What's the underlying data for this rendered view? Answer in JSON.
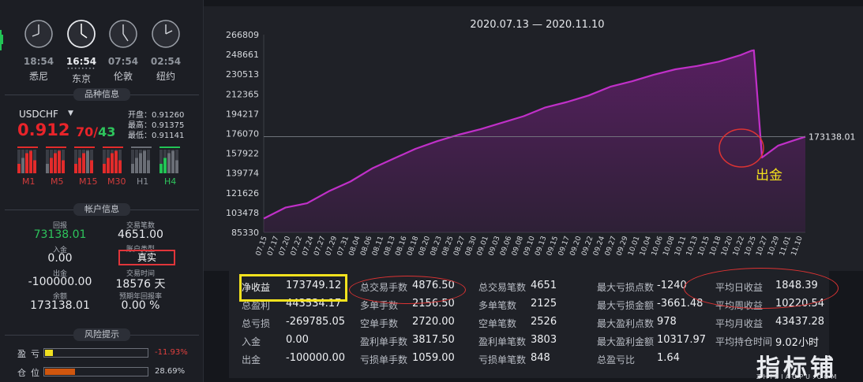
{
  "clocks": [
    {
      "time": "18:54",
      "city": "悉尼",
      "active": false
    },
    {
      "time": "16:54",
      "city": "东京",
      "active": true
    },
    {
      "time": "07:54",
      "city": "伦敦",
      "active": false
    },
    {
      "time": "02:54",
      "city": "纽约",
      "active": false
    }
  ],
  "sections": {
    "instrument": "品种信息",
    "account": "帐户信息",
    "risk": "风险提示"
  },
  "instrument": {
    "symbol": "USDCHF",
    "price_main": "0.912",
    "price_frac": "70",
    "price_sep": "/",
    "price_alt": "43",
    "open": "开盘：0.91260",
    "high": "最高：0.91375",
    "low": "最低：0.91141",
    "timeframes": [
      "M1",
      "M5",
      "M15",
      "M30",
      "H1",
      "H4"
    ],
    "bar_colors": {
      "red": "#e22b2b",
      "green": "#22c455",
      "gray": "#6a6e76"
    }
  },
  "account": {
    "equity_label": "回报",
    "equity": "73138.01",
    "trades_label": "交易笔数",
    "trades": "4651.00",
    "deposit_label": "入金",
    "deposit": "0.00",
    "type_label": "账户类型",
    "type": "真实",
    "withdraw_label": "出金",
    "withdraw": "-100000.00",
    "time_label": "交易时间",
    "time": "18576 天",
    "balance_label": "余额",
    "balance": "173138.01",
    "annual_label": "预期年回报率",
    "annual": "0.00 %"
  },
  "risk": {
    "pl_label": "盈亏",
    "pl_value": "-11.93%",
    "pl_fraction": 0.08,
    "pos_label": "仓位",
    "pos_value": "28.69%",
    "pos_fraction": 0.2869,
    "pl_color": "#f0e020",
    "pos_color": "#d0560e"
  },
  "chart_data": {
    "type": "area",
    "title": "2020.07.13 — 2020.11.10",
    "y_ticks": [
      "266809",
      "248661",
      "230513",
      "212365",
      "194217",
      "176070",
      "157922",
      "139774",
      "121626",
      "103478",
      "85330"
    ],
    "ylim": [
      85330,
      266809
    ],
    "x_ticks": [
      "07.15",
      "07.17",
      "07.20",
      "07.22",
      "07.24",
      "07.27",
      "07.29",
      "07.31",
      "08.04",
      "08.06",
      "08.11",
      "08.13",
      "08.16",
      "08.18",
      "08.20",
      "08.23",
      "08.25",
      "08.27",
      "08.30",
      "09.01",
      "09.03",
      "09.06",
      "09.08",
      "09.10",
      "09.13",
      "09.15",
      "09.17",
      "09.20",
      "09.22",
      "09.24",
      "09.27",
      "09.29",
      "10.01",
      "10.04",
      "10.06",
      "10.08",
      "10.11",
      "10.13",
      "10.15",
      "10.18",
      "10.20",
      "10.22",
      "10.25",
      "10.27",
      "10.29",
      "11.01",
      "11.10"
    ],
    "last_value": "173138.01",
    "annotation": "出金",
    "series": [
      {
        "x": [
          0,
          0.04,
          0.08,
          0.12,
          0.16,
          0.2,
          0.24,
          0.28,
          0.32,
          0.36,
          0.4,
          0.44,
          0.48,
          0.52,
          0.56,
          0.6,
          0.64,
          0.68,
          0.72,
          0.76,
          0.8,
          0.84,
          0.88,
          0.9,
          0.905,
          0.92,
          0.95,
          0.98,
          1.0
        ],
        "values": [
          98000,
          108000,
          112000,
          123000,
          132000,
          144000,
          153000,
          162000,
          169000,
          175000,
          180000,
          186000,
          192000,
          200000,
          205000,
          211000,
          219000,
          224000,
          230000,
          235000,
          238000,
          242000,
          248000,
          252000,
          252500,
          154000,
          165000,
          170000,
          173138
        ]
      }
    ],
    "colors": {
      "line": "#c030c8",
      "fill": "#5a1f63"
    }
  },
  "stats": [
    [
      {
        "label": "净收益",
        "value": "173749.12"
      },
      {
        "label": "总盈利",
        "value": "443534.17"
      },
      {
        "label": "总亏损",
        "value": "-269785.05"
      },
      {
        "label": "入金",
        "value": "0.00"
      },
      {
        "label": "出金",
        "value": "-100000.00"
      }
    ],
    [
      {
        "label": "总交易手数",
        "value": "4876.50"
      },
      {
        "label": "多单手数",
        "value": "2156.50"
      },
      {
        "label": "空单手数",
        "value": "2720.00"
      },
      {
        "label": "盈利单手数",
        "value": "3817.50"
      },
      {
        "label": "亏损单手数",
        "value": "1059.00"
      }
    ],
    [
      {
        "label": "总交易笔数",
        "value": "4651"
      },
      {
        "label": "多单笔数",
        "value": "2125"
      },
      {
        "label": "空单笔数",
        "value": "2526"
      },
      {
        "label": "盈利单笔数",
        "value": "3803"
      },
      {
        "label": "亏损单笔数",
        "value": "848"
      }
    ],
    [
      {
        "label": "最大亏损点数",
        "value": "-1240"
      },
      {
        "label": "最大亏损金额",
        "value": "-3661.48"
      },
      {
        "label": "最大盈利点数",
        "value": "978"
      },
      {
        "label": "最大盈利金额",
        "value": "10317.97"
      },
      {
        "label": "总盈亏比",
        "value": "1.64"
      }
    ],
    [
      {
        "label": "平均日收益",
        "value": "1848.39"
      },
      {
        "label": "平均周收益",
        "value": "10220.54"
      },
      {
        "label": "平均月收益",
        "value": "43437.28"
      },
      {
        "label": "平均持仓时间",
        "value": "9.02小时"
      }
    ]
  ],
  "watermark": {
    "main": "指标铺",
    "sub": "ZHIBIAOPU.COM"
  }
}
